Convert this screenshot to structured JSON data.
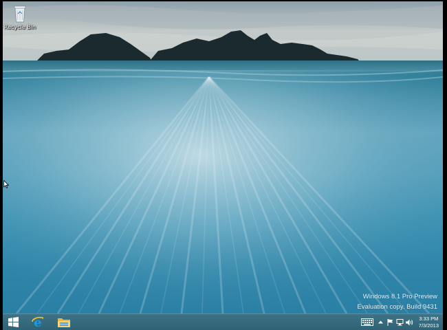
{
  "desktop": {
    "icons": [
      {
        "label": "Recycle Bin",
        "icon": "recycle-bin-icon"
      }
    ],
    "watermark": {
      "line1": "Windows 8.1 Pro Preview",
      "line2": "Evaluation copy. Build 9431"
    }
  },
  "taskbar": {
    "pinned": [
      {
        "name": "start",
        "icon": "windows-logo-icon"
      },
      {
        "name": "internet-explorer",
        "icon": "internet-explorer-icon"
      },
      {
        "name": "file-explorer",
        "icon": "folder-icon"
      }
    ],
    "tray": {
      "icons": [
        "keyboard-icon",
        "chevron-up-icon",
        "flag-icon",
        "network-icon",
        "speaker-icon"
      ],
      "time": "3:33 PM",
      "date": "7/3/2013"
    },
    "colors": {
      "taskbar": "#3e7387",
      "accent": "#1e9be0"
    }
  }
}
